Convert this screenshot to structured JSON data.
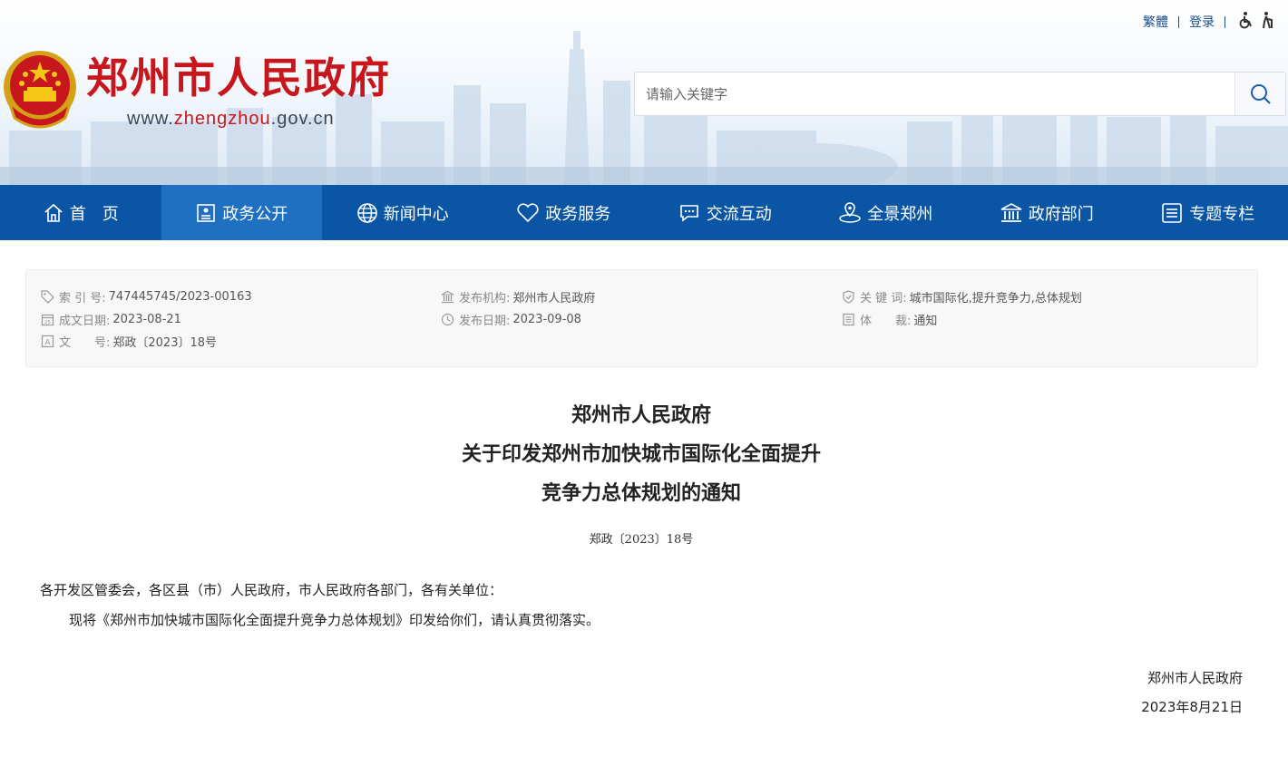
{
  "header": {
    "toplinks": {
      "traditional": "繁體",
      "login": "登录"
    },
    "site_title": "郑州市人民政府",
    "site_url_prefix": "www.",
    "site_url_highlight": "zhengzhou",
    "site_url_suffix": ".gov.cn",
    "search_placeholder": "请输入关键字"
  },
  "nav": {
    "items": [
      {
        "label": "首　页",
        "icon": "home-icon"
      },
      {
        "label": "政务公开",
        "icon": "document-icon",
        "active": true
      },
      {
        "label": "新闻中心",
        "icon": "globe-icon"
      },
      {
        "label": "政务服务",
        "icon": "heart-icon"
      },
      {
        "label": "交流互动",
        "icon": "chat-icon"
      },
      {
        "label": "全景郑州",
        "icon": "location-icon"
      },
      {
        "label": "政府部门",
        "icon": "building-icon"
      },
      {
        "label": "专题专栏",
        "icon": "list-icon"
      }
    ]
  },
  "meta": {
    "index_label": "索 引 号:",
    "index_value": "747445745/2023-00163",
    "issuer_label": "发布机构:",
    "issuer_value": "郑州市人民政府",
    "keywords_label": "关 键 词:",
    "keywords_value": "城市国际化,提升竞争力,总体规划",
    "created_label": "成文日期:",
    "created_value": "2023-08-21",
    "published_label": "发布日期:",
    "published_value": "2023-09-08",
    "genre_label": "体　　裁:",
    "genre_value": "通知",
    "docno_label": "文　　号:",
    "docno_value": "郑政〔2023〕18号"
  },
  "doc": {
    "title_lines": [
      "郑州市人民政府",
      "关于印发郑州市加快城市国际化全面提升",
      "竞争力总体规划的通知"
    ],
    "doc_number": "郑政〔2023〕18号",
    "salutation": "各开发区管委会，各区县（市）人民政府，市人民政府各部门，各有关单位：",
    "body": "现将《郑州市加快城市国际化全面提升竞争力总体规划》印发给你们，请认真贯彻落实。",
    "sign_org": "郑州市人民政府",
    "sign_date": "2023年8月21日"
  },
  "colors": {
    "brand_red": "#c8161d",
    "nav_blue": "#0b56a4",
    "nav_active": "#1f6fc2"
  }
}
